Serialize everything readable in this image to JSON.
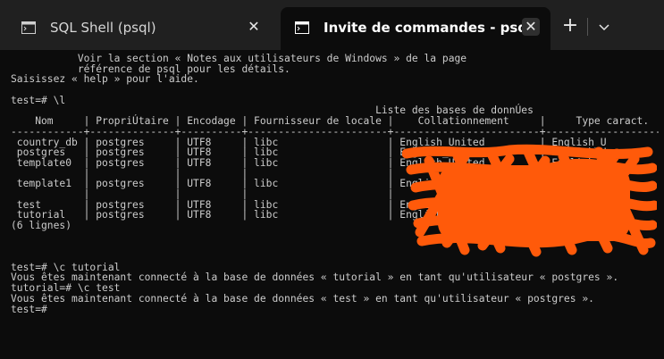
{
  "tabs": [
    {
      "title": "SQL Shell (psql)",
      "active": false
    },
    {
      "title": "Invite de commandes - psql",
      "active": true
    }
  ],
  "tab_bar": {
    "close_glyph": "✕",
    "new_tab_glyph": "+",
    "dropdown_icon": "chevron-down-icon"
  },
  "colors": {
    "terminal_bg": "#0c0c0c",
    "terminal_fg": "#cccccc",
    "tab_bar_bg": "#202020",
    "redaction": "#ff5a0a"
  },
  "terminal": {
    "lines": [
      "           Voir la section « Notes aux utilisateurs de Windows » de la page",
      "           référence de psql pour les détails.",
      "Saisissez « help » pour l'aide.",
      "",
      "test=# \\l",
      "                                                            Liste des bases de donnÚes",
      "    Nom     | PropriÚtaire | Encodage | Fournisseur de locale |    Collationnement     |     Type caract.",
      "------------+--------------+----------+-----------------------+------------------------+---------------------",
      " country_db | postgres     | UTF8     | libc                  | English_United         | English_U",
      " postgres   | postgres     | UTF8     | libc                  | English_United         | English_U",
      " template0  | postgres     | UTF8     | libc                  | English_United         | English_U",
      "            |              |          |                       |                        |",
      " template1  | postgres     | UTF8     | libc                  | English_United         | English_U",
      "            |              |          |                       |                        |",
      " test       | postgres     | UTF8     | libc                  | English_United         | English_U",
      " tutorial   | postgres     | UTF8     | libc                  | English_United         | English_U",
      "(6 lignes)",
      "",
      "",
      "",
      "test=# \\c tutorial",
      "Vous êtes maintenant connecté à la base de données « tutorial » en tant qu'utilisateur « postgres ».",
      "tutorial=# \\c test",
      "Vous êtes maintenant connecté à la base de données « test » en tant qu'utilisateur « postgres ».",
      "test=#"
    ]
  }
}
